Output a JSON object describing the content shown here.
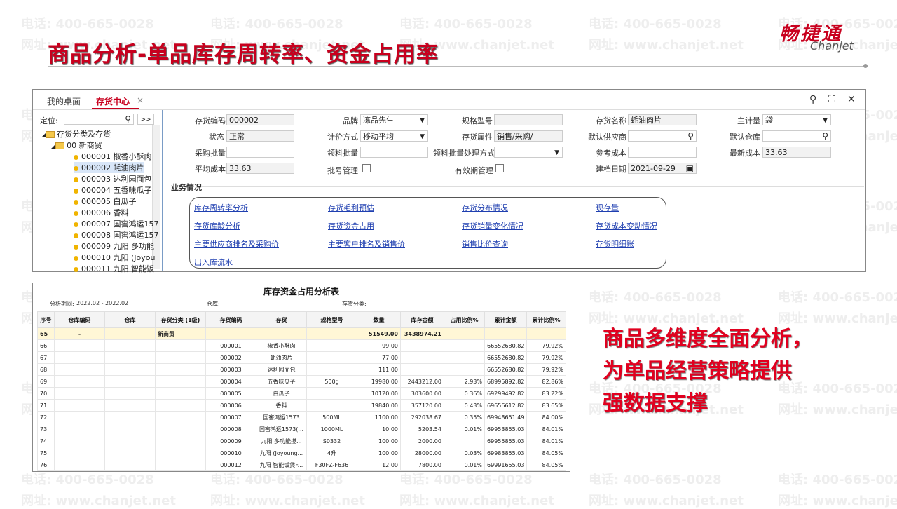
{
  "slide": {
    "title": "商品分析-单品库存周转率、资金占用率",
    "logo_cn": "畅捷通",
    "logo_en": "Chanjet",
    "side_text": [
      "商品多维度全面分析，",
      "为单品经营策略提供",
      "强数据支撑"
    ]
  },
  "watermark": {
    "phone": "电话: 400-665-0028",
    "site": "网址: www.chanjet.net"
  },
  "window": {
    "tabs": [
      {
        "label": "我的桌面"
      },
      {
        "label": "存货中心"
      }
    ],
    "tab_close": "×",
    "tools": {
      "search": "⚲",
      "expand": "⛶",
      "close": "✕"
    },
    "locate": {
      "label": "定位:",
      "value": "",
      "go": ">>"
    },
    "tree": {
      "root": "存货分类及存货",
      "group": "00 新商贸",
      "items": [
        "000001 椒香小酥肉",
        "000002 蚝油肉片",
        "000003 达利园面包",
        "000004 五香味瓜子",
        "000005 白瓜子",
        "000006 香料",
        "000007 国窖鸿运157",
        "000008 国窖鸿运157",
        "000009 九阳 多功能",
        "000010 九阳 (Joyou",
        "000011 九阳 智能饭"
      ]
    },
    "form": {
      "code_label": "存货编码",
      "code": "000002",
      "brand_label": "品牌",
      "brand": "冻品先生",
      "spec_label": "规格型号",
      "spec": "",
      "name_label": "存货名称",
      "name": "蚝油肉片",
      "unit_label": "主计量",
      "unit": "袋",
      "status_label": "状态",
      "status": "正常",
      "price_method_label": "计价方式",
      "price_method": "移动平均",
      "attr_label": "存货属性",
      "attr": "销售/采购/",
      "supplier_label": "默认供应商",
      "supplier": "",
      "warehouse_label": "默认仓库",
      "warehouse": "",
      "purchase_batch_label": "采购批量",
      "purchase_batch": "",
      "pick_batch_label": "领料批量",
      "pick_batch": "",
      "pick_method_label": "领料批量处理方式",
      "pick_method": "",
      "ref_cost_label": "参考成本",
      "ref_cost": "",
      "latest_cost_label": "最新成本",
      "latest_cost": "33.63",
      "avg_cost_label": "平均成本",
      "avg_cost": "33.63",
      "batch_mgmt_label": "批号管理",
      "expiry_mgmt_label": "有效期管理",
      "created_label": "建档日期",
      "created": "2021-09-29"
    },
    "business": {
      "heading": "业务情况",
      "links": [
        "库存周转率分析",
        "存货毛利预估",
        "存货分布情况",
        "现存量",
        "存货库龄分析",
        "存货资金占用",
        "存货销量变化情况",
        "存货成本变动情况",
        "主要供应商排名及采购价",
        "主要客户排名及销售价",
        "销售比价查询",
        "存货明细账",
        "出入库流水"
      ]
    }
  },
  "report": {
    "title": "库存资金占用分析表",
    "period_label": "分析期间:",
    "period": "2022.02 - 2022.02",
    "warehouse_label": "仓库:",
    "category_label": "存货分类:",
    "columns": [
      "序号",
      "仓库编码",
      "仓库",
      "存货分类 (1级)",
      "存货编码",
      "存货",
      "规格型号",
      "数量",
      "库存金额",
      "占用比例%",
      "累计金额",
      "累计比例%"
    ],
    "rows": [
      [
        "65",
        "-",
        "",
        "新商贸",
        "",
        "",
        "",
        "51549.00",
        "3438974.21",
        "",
        "",
        ""
      ],
      [
        "66",
        "",
        "",
        "",
        "000001",
        "椒香小酥肉",
        "",
        "99.00",
        "",
        "",
        "66552680.82",
        "79.92%"
      ],
      [
        "67",
        "",
        "",
        "",
        "000002",
        "蚝油肉片",
        "",
        "77.00",
        "",
        "",
        "66552680.82",
        "79.92%"
      ],
      [
        "68",
        "",
        "",
        "",
        "000003",
        "达利园面包",
        "",
        "111.00",
        "",
        "",
        "66552680.82",
        "79.92%"
      ],
      [
        "69",
        "",
        "",
        "",
        "000004",
        "五香味瓜子",
        "500g",
        "19980.00",
        "2443212.00",
        "2.93%",
        "68995892.82",
        "82.86%"
      ],
      [
        "70",
        "",
        "",
        "",
        "000005",
        "白瓜子",
        "",
        "10120.00",
        "303600.00",
        "0.36%",
        "69299492.82",
        "83.22%"
      ],
      [
        "71",
        "",
        "",
        "",
        "000006",
        "香料",
        "",
        "19840.00",
        "357120.00",
        "0.43%",
        "69656612.82",
        "83.65%"
      ],
      [
        "72",
        "",
        "",
        "",
        "000007",
        "国窖鸿运1573",
        "500ML",
        "1100.00",
        "292038.67",
        "0.35%",
        "69948651.49",
        "84.00%"
      ],
      [
        "73",
        "",
        "",
        "",
        "000008",
        "国窖鸿运1573(...",
        "1000ML",
        "10.00",
        "5203.54",
        "0.01%",
        "69953855.03",
        "84.01%"
      ],
      [
        "74",
        "",
        "",
        "",
        "000009",
        "九阳 多功能搅...",
        "S0332",
        "100.00",
        "2000.00",
        "",
        "69955855.03",
        "84.01%"
      ],
      [
        "75",
        "",
        "",
        "",
        "000010",
        "九阳 (Joyoung...",
        "4升",
        "100.00",
        "28000.00",
        "0.03%",
        "69983855.03",
        "84.05%"
      ],
      [
        "76",
        "",
        "",
        "",
        "000012",
        "九阳 智能饭煲F...",
        "F30FZ-F636",
        "12.00",
        "7800.00",
        "0.01%",
        "69991655.03",
        "84.05%"
      ]
    ]
  }
}
